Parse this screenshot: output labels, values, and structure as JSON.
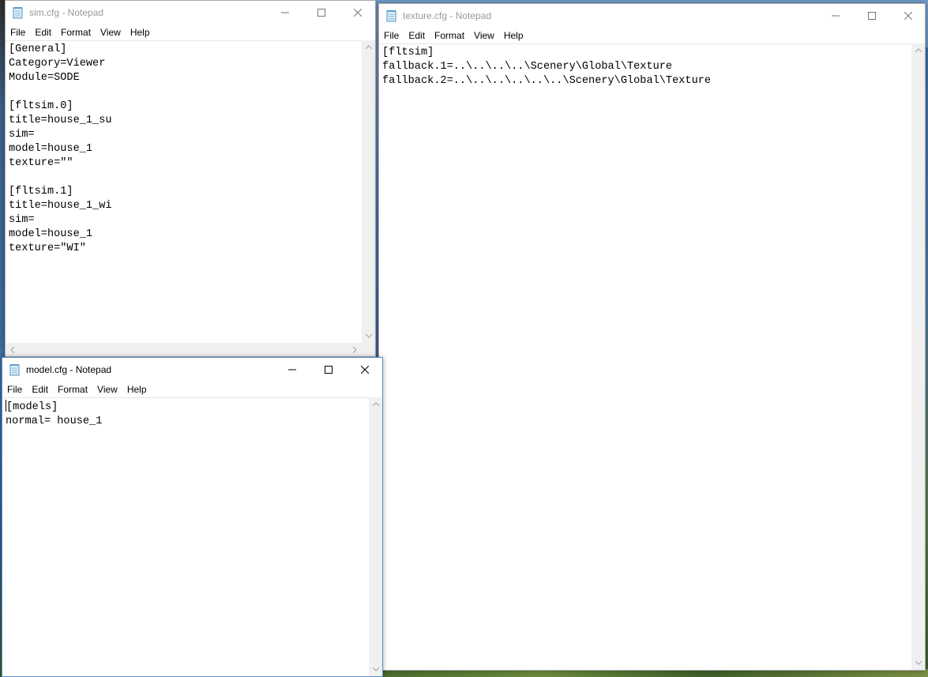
{
  "sim_window": {
    "title": "sim.cfg - Notepad",
    "menu": [
      "File",
      "Edit",
      "Format",
      "View",
      "Help"
    ],
    "content": "[General]\nCategory=Viewer\nModule=SODE\n\n[fltsim.0]\ntitle=house_1_su\nsim=\nmodel=house_1\ntexture=\"\"\n\n[fltsim.1]\ntitle=house_1_wi\nsim=\nmodel=house_1\ntexture=\"WI\""
  },
  "texture_window": {
    "title": "texture.cfg - Notepad",
    "menu": [
      "File",
      "Edit",
      "Format",
      "View",
      "Help"
    ],
    "content": "[fltsim]\nfallback.1=..\\..\\..\\..\\Scenery\\Global\\Texture\nfallback.2=..\\..\\..\\..\\..\\..\\Scenery\\Global\\Texture"
  },
  "model_window": {
    "title": "model.cfg - Notepad",
    "menu": [
      "File",
      "Edit",
      "Format",
      "View",
      "Help"
    ],
    "content_line1_rest": "models]",
    "content_line1_start": "[",
    "content_rest": "normal= house_1"
  },
  "icons": {
    "app": "notepad-icon",
    "minimize": "minimize-icon",
    "maximize": "maximize-icon",
    "close": "close-icon"
  },
  "colors": {
    "active_border": "#5f8fc4",
    "inactive_title": "#999999",
    "scrollbar_bg": "#f0f0f0"
  }
}
